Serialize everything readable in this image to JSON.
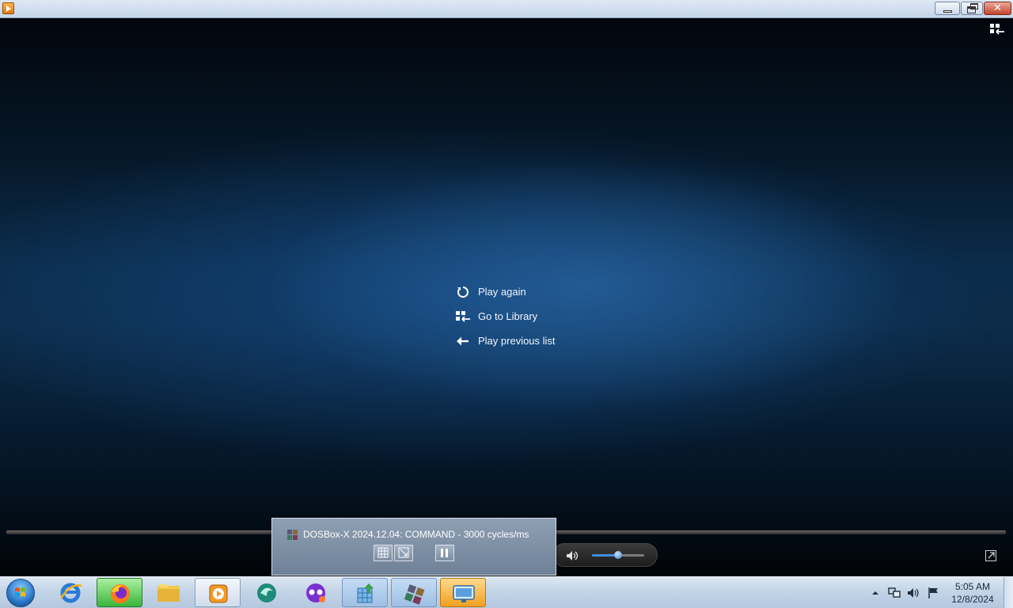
{
  "window": {
    "app_icon": "media-player-icon",
    "buttons": {
      "minimize": "minimize-icon",
      "maximize": "restore-icon",
      "close": "close-icon"
    }
  },
  "player": {
    "switch_view_icon": "switch-to-library-icon",
    "menu": [
      {
        "icon": "replay-icon",
        "label": "Play again"
      },
      {
        "icon": "library-icon",
        "label": "Go to Library"
      },
      {
        "icon": "back-arrow-icon",
        "label": "Play previous list"
      }
    ],
    "volume": {
      "icon": "speaker-icon",
      "level": 0.5
    },
    "fullscreen_icon": "fullscreen-icon"
  },
  "thumbnail_popup": {
    "icon": "dosbox-icon",
    "title": "DOSBox-X 2024.12.04: COMMAND - 3000 cycles/ms",
    "buttons": [
      "grid-icon",
      "resize-icon",
      "pause-icon"
    ]
  },
  "taskbar": {
    "items": [
      {
        "icon": "internet-explorer-icon",
        "state": "normal"
      },
      {
        "icon": "firefox-icon",
        "state": "hot"
      },
      {
        "icon": "file-explorer-icon",
        "state": "normal"
      },
      {
        "icon": "media-player-icon",
        "state": "active"
      },
      {
        "icon": "app-swirl-icon",
        "state": "normal"
      },
      {
        "icon": "app-mask-icon",
        "state": "normal"
      },
      {
        "icon": "installer-icon",
        "state": "blue"
      },
      {
        "icon": "dosbox-icon",
        "state": "blue"
      },
      {
        "icon": "remote-desktop-icon",
        "state": "orange"
      }
    ],
    "tray_icons": [
      "show-hidden-icons-icon",
      "network-icon",
      "volume-icon",
      "action-center-flag-icon"
    ],
    "clock": {
      "time": "5:05 AM",
      "date": "12/8/2024"
    }
  },
  "colors": {
    "accent": "#3d8ee0",
    "video_bg": "#0b2c4b",
    "taskbar": "#c3d4e7"
  }
}
